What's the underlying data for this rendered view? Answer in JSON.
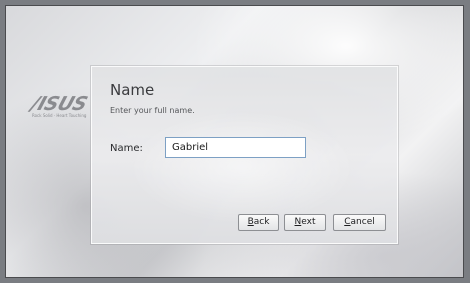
{
  "branding": {
    "logo_text": "/ISUS",
    "tagline": "Rock Solid · Heart Touching"
  },
  "dialog": {
    "title": "Name",
    "subtitle": "Enter your full name.",
    "name_label": "Name:",
    "name_value": "Gabriel"
  },
  "buttons": {
    "back": {
      "mnemonic": "B",
      "rest": "ack"
    },
    "next": {
      "mnemonic": "N",
      "rest": "ext"
    },
    "cancel": {
      "mnemonic": "C",
      "rest": "ancel"
    }
  }
}
